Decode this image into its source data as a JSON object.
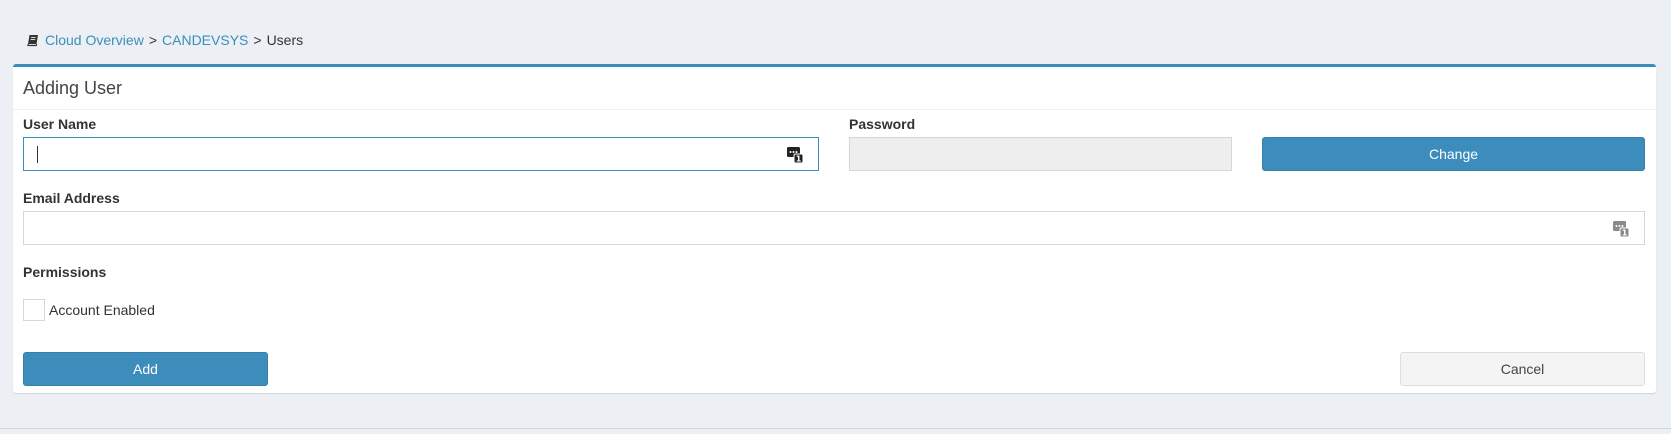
{
  "breadcrumb": {
    "icon": "book-icon",
    "items": [
      {
        "label": "Cloud Overview",
        "link": true
      },
      {
        "label": "CANDEVSYS",
        "link": true
      },
      {
        "label": "Users",
        "link": false
      }
    ],
    "separator": ">"
  },
  "box": {
    "title": "Adding User",
    "accent_color": "#3c8dbc"
  },
  "form": {
    "username": {
      "label": "User Name",
      "value": "",
      "placeholder": "",
      "icon": "password-manager-icon"
    },
    "password": {
      "label": "Password",
      "value": "",
      "change_label": "Change"
    },
    "email": {
      "label": "Email Address",
      "value": "",
      "placeholder": "",
      "icon": "password-manager-icon"
    },
    "permissions": {
      "label": "Permissions",
      "account_enabled": {
        "label": "Account Enabled",
        "checked": false
      }
    },
    "actions": {
      "add_label": "Add",
      "cancel_label": "Cancel"
    }
  }
}
